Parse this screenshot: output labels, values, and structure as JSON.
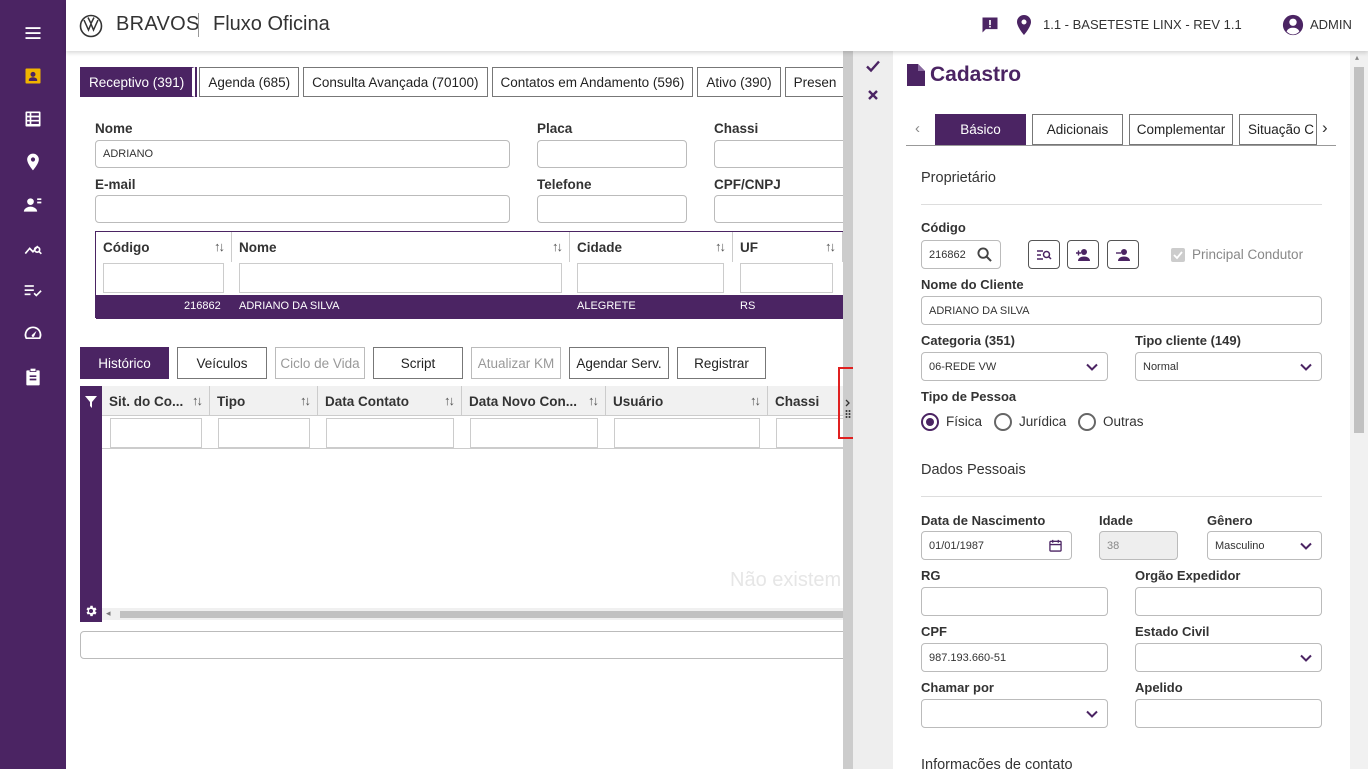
{
  "header": {
    "brand": "BRAVOS",
    "app_name": "Fluxo Oficina",
    "location": "1.1 - BASETESTE LINX - REV 1.1",
    "user": "ADMIN"
  },
  "sidebar": {
    "items": [
      {
        "icon": "menu-icon"
      },
      {
        "icon": "contact-card-icon",
        "active": true
      },
      {
        "icon": "list-icon"
      },
      {
        "icon": "location-pin-icon"
      },
      {
        "icon": "people-icon"
      },
      {
        "icon": "chart-search-icon"
      },
      {
        "icon": "checklist-icon"
      },
      {
        "icon": "speedometer-icon"
      },
      {
        "icon": "clipboard-icon"
      }
    ]
  },
  "main": {
    "tabs": [
      "Receptivo (391)",
      "Agenda (685)",
      "Consulta Avançada (70100)",
      "Contatos em Andamento (596)",
      "Ativo (390)",
      "Presen"
    ],
    "search": {
      "nome_label": "Nome",
      "nome_value": "ADRIANO",
      "placa_label": "Placa",
      "chassi_label": "Chassi",
      "email_label": "E-mail",
      "telefone_label": "Telefone",
      "cpf_label": "CPF/CNPJ"
    },
    "results": {
      "columns": [
        "Código",
        "Nome",
        "Cidade",
        "UF"
      ],
      "rows": [
        {
          "codigo": "216862",
          "nome": "ADRIANO DA SILVA",
          "cidade": "ALEGRETE",
          "uf": "RS"
        }
      ]
    },
    "sub_tabs": [
      "Histórico",
      "Veículos",
      "Ciclo de Vida",
      "Script",
      "Atualizar KM",
      "Agendar Serv.",
      "Registrar"
    ],
    "history": {
      "columns": [
        "Sit. do Co...",
        "Tipo",
        "Data Contato",
        "Data Novo Con...",
        "Usuário",
        "Chassi"
      ],
      "empty_message": "Não existem"
    }
  },
  "panel": {
    "title": "Cadastro",
    "tabs": [
      "Básico",
      "Adicionais",
      "Complementar",
      "Situação C"
    ],
    "proprietario": "Proprietário",
    "codigo_label": "Código",
    "codigo_value": "216862",
    "principal_condutor": "Principal Condutor",
    "nome_cliente_label": "Nome do Cliente",
    "nome_cliente_value": "ADRIANO DA SILVA",
    "categoria_label": "Categoria (351)",
    "categoria_value": "06-REDE VW",
    "tipo_cliente_label": "Tipo cliente (149)",
    "tipo_cliente_value": "Normal",
    "tipo_pessoa_label": "Tipo de Pessoa",
    "tipo_pessoa_options": [
      "Física",
      "Jurídica",
      "Outras"
    ],
    "dados_pessoais": "Dados Pessoais",
    "nascimento_label": "Data de Nascimento",
    "nascimento_value": "01/01/1987",
    "idade_label": "Idade",
    "idade_value": "38",
    "genero_label": "Gênero",
    "genero_value": "Masculino",
    "rg_label": "RG",
    "orgao_label": "Orgão Expedidor",
    "cpf_label": "CPF",
    "cpf_value": "987.193.660-51",
    "estado_civil_label": "Estado Civil",
    "chamar_por_label": "Chamar por",
    "apelido_label": "Apelido",
    "informacoes_contato": "Informações de contato"
  },
  "colors": {
    "brand": "#4b2463",
    "active_icon": "#f0b400"
  }
}
